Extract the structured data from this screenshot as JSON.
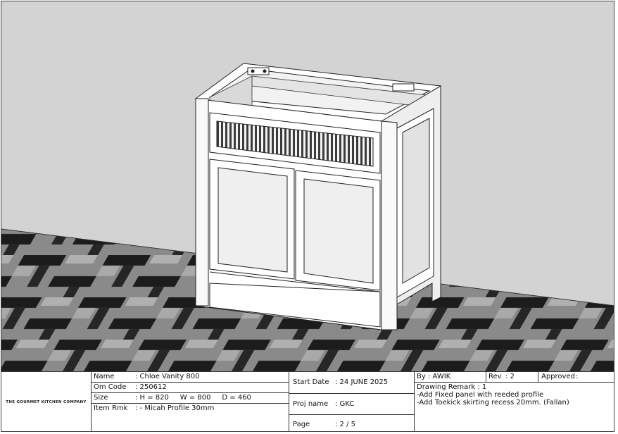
{
  "company": {
    "logo_text": "THE GOURMET KITCHEN COMPANY"
  },
  "details": {
    "name_label": "Name",
    "name_value": ": Chloe Vanity 800",
    "omcode_label": "Om Code",
    "omcode_value": ": 250612",
    "size_label": "Size",
    "size_value": ": H = 820     W = 800     D = 460",
    "itemrmk_label": "Item Rmk",
    "itemrmk_value": ": - Micah Profile 30mm"
  },
  "project": {
    "start_label": "Start Date",
    "start_value": ": 24 JUNE 2025",
    "projname_label": "Proj name",
    "projname_value": ": GKC",
    "page_label": "Page",
    "page_value": ": 2 / 5"
  },
  "revision": {
    "by_label": "By",
    "by_value": ": AWIK",
    "rev_label": "Rev",
    "rev_value": ": 2",
    "approved_label": "Approved",
    "approved_value": ":",
    "remark_title": "Drawing Remark : 1",
    "remarks": [
      "-Add Fixed panel with reeded profile",
      "-Add Toekick skirting recess 20mm. (Fallan)"
    ]
  },
  "colors": {
    "wall": "#d3d3d3",
    "floor_dark": "#1f1f1f",
    "floor_light": "#8e8e8e",
    "cabinet": "#ffffff",
    "cabinet_shade": "#e6e6e6"
  }
}
